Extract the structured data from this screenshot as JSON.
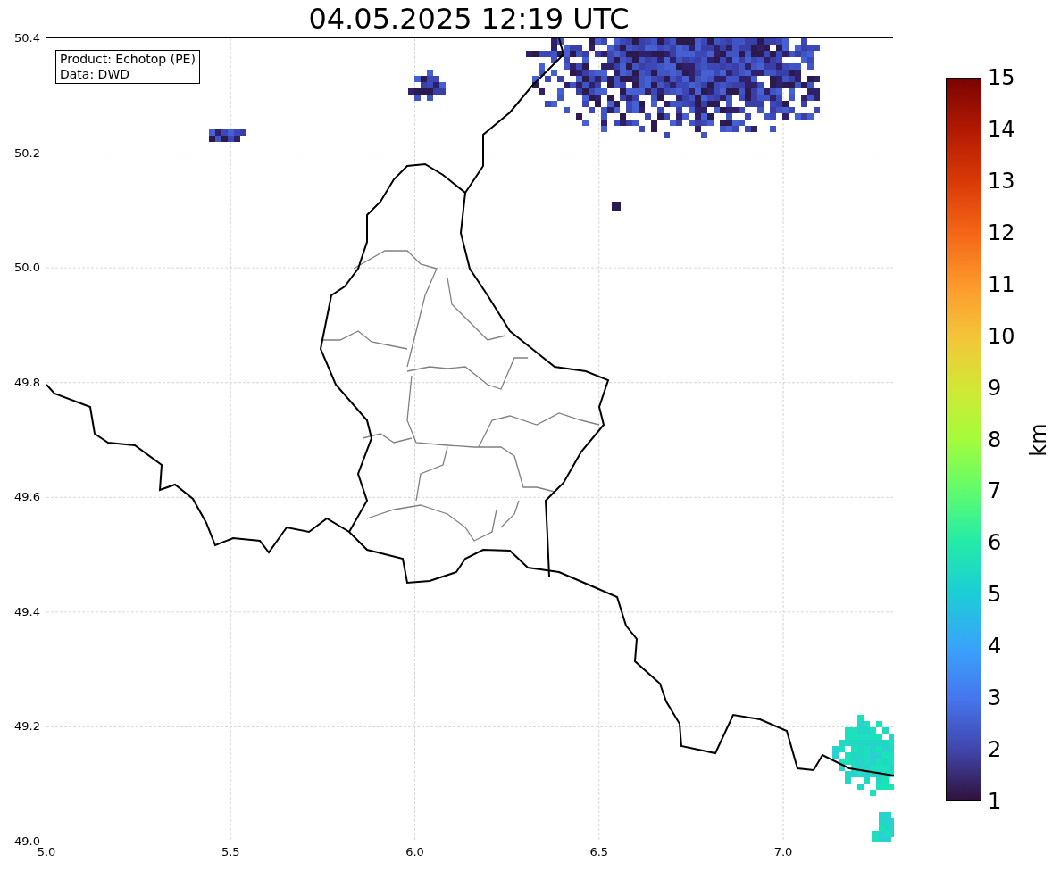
{
  "title": "04.05.2025 12:19 UTC",
  "legend": [
    "Product: Echotop (PE)",
    "Data: DWD"
  ],
  "x_ticks": [
    "5.0",
    "5.5",
    "6.0",
    "6.5",
    "7.0"
  ],
  "y_ticks": [
    "50.4",
    "50.2",
    "50.0",
    "49.8",
    "49.6",
    "49.4",
    "49.2",
    "49.0"
  ],
  "colorbar": {
    "label": "km",
    "ticks": [
      "15",
      "14",
      "13",
      "12",
      "11",
      "10",
      "9",
      "8",
      "7",
      "6",
      "5",
      "4",
      "3",
      "2",
      "1"
    ]
  }
}
